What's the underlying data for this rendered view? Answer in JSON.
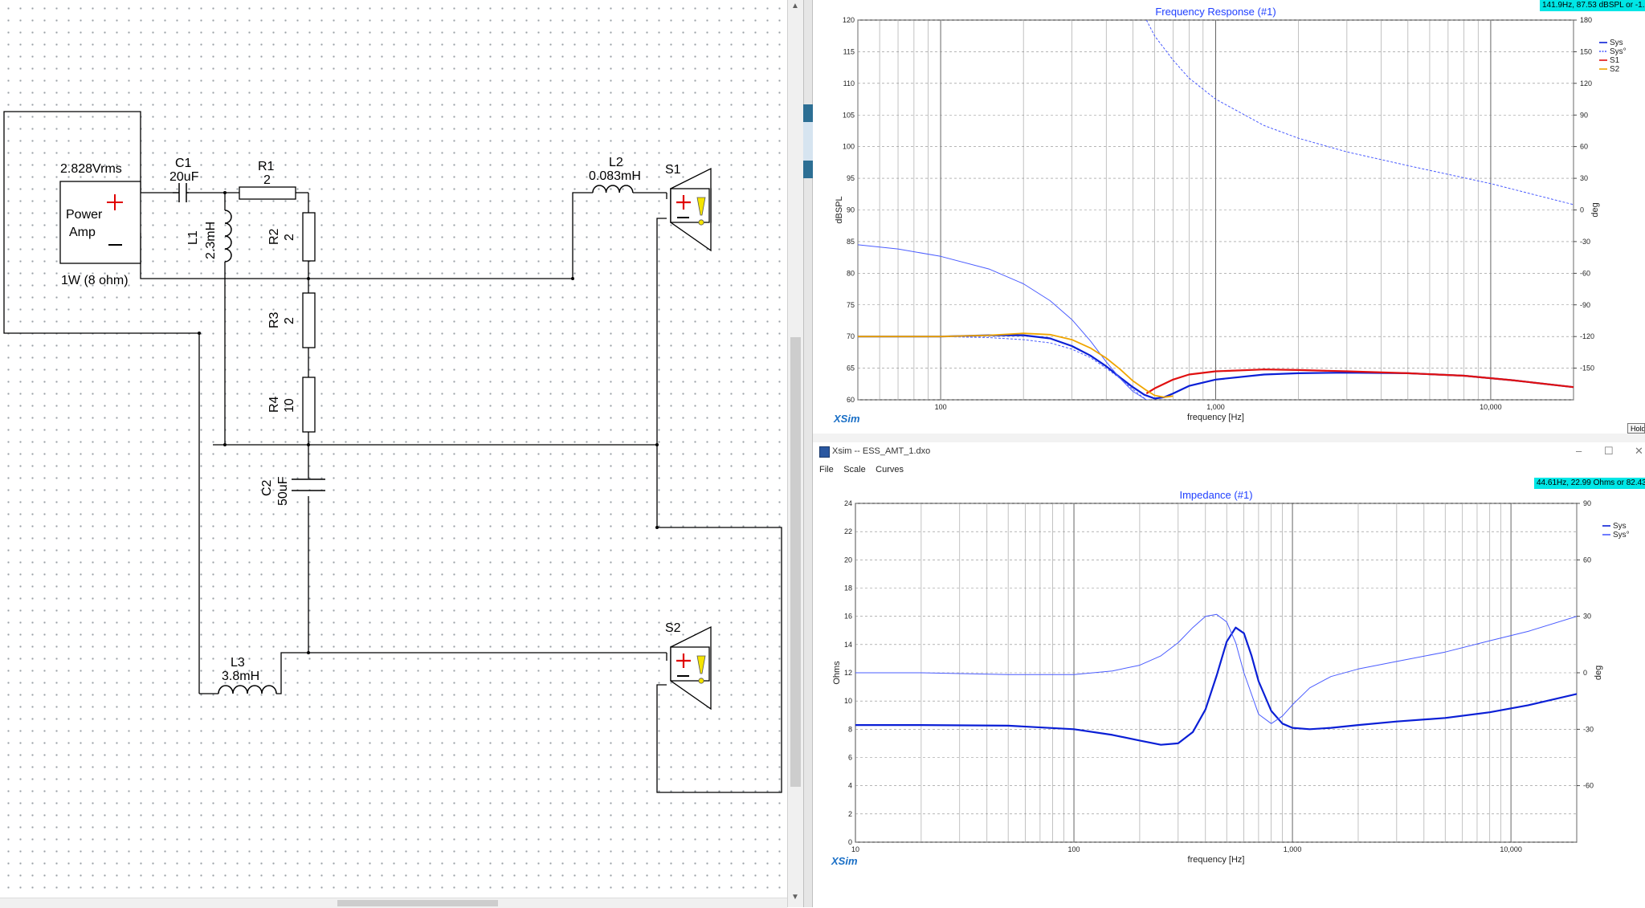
{
  "schematic": {
    "source": {
      "voltage": "2.828Vrms",
      "name_line1": "Power",
      "name_line2": "Amp",
      "rating": "1W (8 ohm)",
      "plus": "+",
      "minus": "—"
    },
    "c1": {
      "name": "C1",
      "value": "20uF"
    },
    "r1": {
      "name": "R1",
      "value": "2"
    },
    "l1": {
      "name": "L1",
      "value": "2.3mH"
    },
    "r2": {
      "name": "R2",
      "value": "2"
    },
    "r3": {
      "name": "R3",
      "value": "2"
    },
    "r4": {
      "name": "R4",
      "value": "10"
    },
    "c2": {
      "name": "C2",
      "value": "50uF"
    },
    "l2": {
      "name": "L2",
      "value": "0.083mH"
    },
    "l3": {
      "name": "L3",
      "value": "3.8mH"
    },
    "s1": {
      "name": "S1"
    },
    "s2": {
      "name": "S2"
    }
  },
  "freq_window": {
    "cursor_readout": "141.9Hz, 87.53 dBSPL or -1...",
    "hold_label": "Hold",
    "xsim_label": "XSim"
  },
  "imp_window": {
    "title": "Xsim -- ESS_AMT_1.dxo",
    "menu": [
      "File",
      "Scale",
      "Curves"
    ],
    "cursor_readout": "44.61Hz, 22.99 Ohms or 82.43...",
    "xsim_label": "XSim"
  },
  "colors": {
    "sys": "#0a1fd6",
    "sys_phase": "#4a5cff",
    "s1": "#e01010",
    "s2": "#f0a500",
    "title": "#1f3fff",
    "readout": "#00e6e6"
  },
  "chart_data": [
    {
      "type": "line",
      "title": "Frequency Response (#1)",
      "xlabel": "frequency [Hz]",
      "ylabel": "dBSPL",
      "y2label": "deg",
      "xscale": "log",
      "xlim": [
        50,
        20000
      ],
      "ylim": [
        60,
        120
      ],
      "y2lim": [
        -180,
        180
      ],
      "xticks": [
        {
          "v": 100,
          "label": "100"
        },
        {
          "v": 1000,
          "label": "1,000"
        },
        {
          "v": 10000,
          "label": "10,000"
        }
      ],
      "yticks": [
        60,
        65,
        70,
        75,
        80,
        85,
        90,
        95,
        100,
        105,
        110,
        115,
        120
      ],
      "y2ticks": [
        "180",
        "150",
        "120",
        "90",
        "60",
        "30",
        "0",
        "-30",
        "-60",
        "-90",
        "-120",
        "-150"
      ],
      "grid": true,
      "legend_position": "top-right",
      "series": [
        {
          "name": "Sys",
          "axis": "left",
          "dashed": false,
          "width": 2.2,
          "x": [
            50,
            100,
            150,
            200,
            250,
            300,
            350,
            400,
            450,
            500,
            550,
            600,
            650,
            700,
            800,
            1000,
            1500,
            2000,
            3000,
            5000,
            8000,
            12000,
            20000
          ],
          "y": [
            70,
            70,
            70.2,
            70.2,
            69.7,
            68.5,
            67,
            65.3,
            63.5,
            62,
            60.8,
            60.2,
            60.4,
            61,
            62.2,
            63.2,
            64,
            64.2,
            64.3,
            64.2,
            63.8,
            63.1,
            62
          ]
        },
        {
          "name": "Sys°",
          "axis": "right",
          "dashed": true,
          "width": 1,
          "x": [
            50,
            70,
            100,
            150,
            200,
            250,
            300,
            350,
            400,
            450,
            500,
            540,
            560,
            570,
            580
          ],
          "y": [
            -120,
            -120,
            -120,
            -121,
            -123,
            -126,
            -132,
            -140,
            -150,
            -160,
            -170,
            -177,
            -180,
            -180,
            -180
          ]
        },
        {
          "name": "Sys°",
          "axis": "right",
          "dashed": true,
          "width": 1,
          "x": [
            560,
            600,
            700,
            800,
            1000,
            1500,
            2000,
            3000,
            5000,
            10000,
            20000
          ],
          "y": [
            180,
            165,
            142,
            125,
            105,
            80,
            68,
            55,
            42,
            25,
            5
          ]
        },
        {
          "name": "Sys°",
          "axis": "right",
          "dashed": false,
          "width": 1,
          "x": [
            50,
            70,
            100,
            150,
            200,
            250,
            300,
            350,
            400,
            450,
            500,
            560
          ],
          "y": [
            -33,
            -37,
            -44,
            -56,
            -70,
            -86,
            -104,
            -124,
            -144,
            -160,
            -172,
            -180
          ]
        },
        {
          "name": "S1",
          "axis": "left",
          "dashed": false,
          "width": 2.2,
          "x": [
            560,
            600,
            700,
            800,
            1000,
            1500,
            2000,
            3000,
            5000,
            8000,
            12000,
            20000
          ],
          "y": [
            61,
            61.8,
            63.2,
            64,
            64.5,
            64.8,
            64.7,
            64.5,
            64.2,
            63.8,
            63.1,
            62
          ]
        },
        {
          "name": "S2",
          "axis": "left",
          "dashed": false,
          "width": 1.8,
          "x": [
            50,
            100,
            150,
            200,
            250,
            300,
            350,
            400,
            450,
            500,
            560,
            600,
            650,
            700
          ],
          "y": [
            70,
            70,
            70.2,
            70.5,
            70.3,
            69.5,
            68.2,
            66.6,
            64.8,
            63,
            61.5,
            60.7,
            60.4,
            60.6
          ]
        }
      ]
    },
    {
      "type": "line",
      "title": "Impedance (#1)",
      "xlabel": "frequency [Hz]",
      "ylabel": "Ohms",
      "y2label": "deg",
      "xscale": "log",
      "xlim": [
        10,
        20000
      ],
      "ylim": [
        0,
        24
      ],
      "y2lim": [
        -90,
        90
      ],
      "xticks": [
        {
          "v": 10,
          "label": "10"
        },
        {
          "v": 100,
          "label": "100"
        },
        {
          "v": 1000,
          "label": "1,000"
        },
        {
          "v": 10000,
          "label": "10,000"
        }
      ],
      "yticks": [
        0,
        2,
        4,
        6,
        8,
        10,
        12,
        14,
        16,
        18,
        20,
        22,
        24
      ],
      "y2ticks": [
        "90",
        "60",
        "30",
        "0",
        "-30",
        "-60"
      ],
      "grid": true,
      "legend_position": "top-right",
      "series": [
        {
          "name": "Sys",
          "axis": "left",
          "dashed": false,
          "width": 2.2,
          "x": [
            10,
            20,
            50,
            100,
            150,
            200,
            250,
            300,
            350,
            400,
            450,
            500,
            550,
            600,
            650,
            700,
            800,
            900,
            1000,
            1200,
            1500,
            2000,
            3000,
            5000,
            8000,
            12000,
            20000
          ],
          "y": [
            8.3,
            8.3,
            8.25,
            8.0,
            7.6,
            7.2,
            6.9,
            7.0,
            7.8,
            9.4,
            11.8,
            14.2,
            15.2,
            14.8,
            13.2,
            11.4,
            9.3,
            8.4,
            8.1,
            8.0,
            8.1,
            8.3,
            8.55,
            8.8,
            9.2,
            9.7,
            10.5
          ]
        },
        {
          "name": "Sys°",
          "axis": "right",
          "dashed": false,
          "width": 1,
          "x": [
            10,
            20,
            50,
            100,
            150,
            200,
            250,
            300,
            350,
            400,
            450,
            500,
            550,
            600,
            700,
            800,
            900,
            1000,
            1200,
            1500,
            2000,
            3000,
            5000,
            8000,
            12000,
            20000
          ],
          "y": [
            0,
            0,
            -1,
            -1,
            1,
            4,
            9,
            16,
            24,
            30,
            31,
            27,
            16,
            0,
            -22,
            -27,
            -23,
            -17,
            -8,
            -2,
            2,
            6,
            11,
            17,
            22,
            30
          ]
        }
      ]
    }
  ]
}
